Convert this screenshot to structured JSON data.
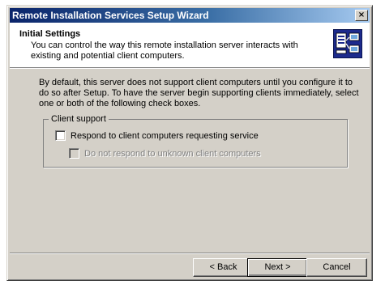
{
  "window": {
    "title": "Remote Installation Services Setup Wizard",
    "close_glyph": "×"
  },
  "header": {
    "title": "Initial Settings",
    "description": "You can control the way this remote installation server interacts with existing and potential client computers.",
    "icon": "server-network-icon"
  },
  "body": {
    "intro": "By default, this server does not support client computers until you configure it to do so after Setup. To have the server begin supporting clients immediately, select one or both of the following check boxes.",
    "group_label": "Client support",
    "options": [
      {
        "label": "Respond to client computers requesting service",
        "checked": false,
        "enabled": true
      },
      {
        "label": "Do not respond to unknown client computers",
        "checked": false,
        "enabled": false
      }
    ]
  },
  "buttons": {
    "back": "< Back",
    "next": "Next >",
    "cancel": "Cancel"
  },
  "colors": {
    "face": "#d4d0c8",
    "title_start": "#0a246a",
    "title_end": "#a6caf0"
  }
}
